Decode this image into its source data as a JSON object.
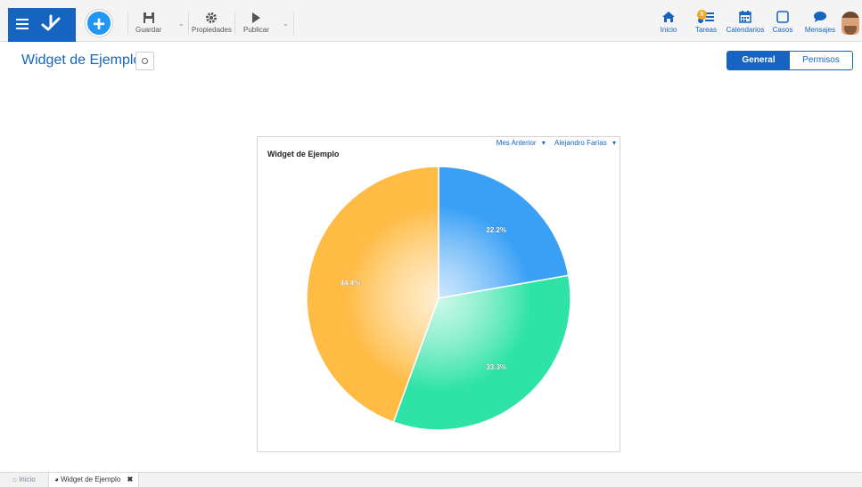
{
  "toolbar": {
    "save_label": "Guardar",
    "properties_label": "Propiedades",
    "publish_label": "Publicar"
  },
  "nav": {
    "home_label": "Inicio",
    "tasks_label": "Tareas",
    "tasks_badge": "5",
    "calendars_label": "Calendarios",
    "cases_label": "Casos",
    "messages_label": "Mensajes"
  },
  "page": {
    "title": "Widget de Ejemplo",
    "tabs": [
      {
        "label": "General",
        "active": true
      },
      {
        "label": "Permisos",
        "active": false
      }
    ]
  },
  "widget": {
    "title": "Widget de Ejemplo",
    "filter_period": "Mes Anterior",
    "filter_user": "Alejandro Farías"
  },
  "chart_data": {
    "type": "pie",
    "title": "Widget de Ejemplo",
    "slices": [
      {
        "label": "22.2%",
        "value": 22.2,
        "color": "#3aa0f5"
      },
      {
        "label": "33.3%",
        "value": 33.3,
        "color": "#2fe3a6"
      },
      {
        "label": "44.4%",
        "value": 44.4,
        "color": "#ffbb44"
      }
    ]
  },
  "bottom_tabs": {
    "home_label": "Inicio",
    "current_label": "Widget de Ejemplo"
  },
  "colors": {
    "brand": "#1565c0",
    "accent": "#2196f3"
  }
}
